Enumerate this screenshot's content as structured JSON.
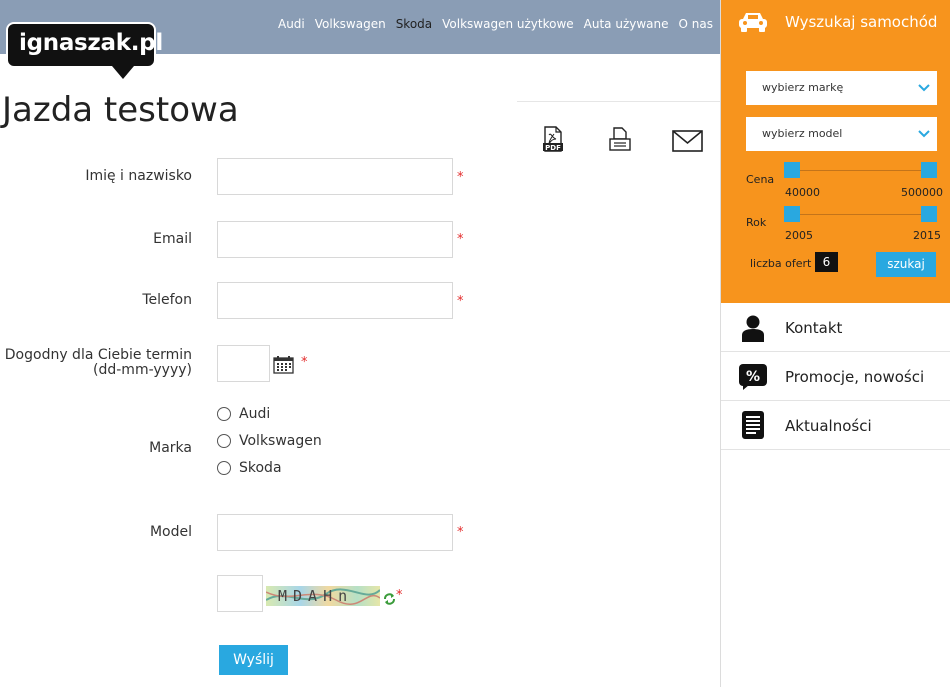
{
  "brand": {
    "logo_text": "ignaszak.pl"
  },
  "nav": {
    "items": [
      {
        "label": "Audi"
      },
      {
        "label": "Volkswagen"
      },
      {
        "label": "Skoda",
        "active": true
      },
      {
        "label": "Volkswagen użytkowe"
      },
      {
        "label": "Auta używane"
      },
      {
        "label": "O nas"
      }
    ]
  },
  "page": {
    "title": "Jazda testowa"
  },
  "tools": {
    "icons": [
      "pdf-icon",
      "print-icon",
      "mail-icon"
    ]
  },
  "form": {
    "name_label": "Imię i nazwisko",
    "email_label": "Email",
    "phone_label": "Telefon",
    "date_label_1": "Dogodny dla Ciebie termin",
    "date_label_2": "(dd-mm-yyyy)",
    "brand_label": "Marka",
    "brands": [
      "Audi",
      "Volkswagen",
      "Skoda"
    ],
    "model_label": "Model",
    "required_mark": "*",
    "captcha_text": "MDAHn",
    "submit_label": "Wyślij"
  },
  "search": {
    "title": "Wyszukaj samochód",
    "make_placeholder": "wybierz markę",
    "model_placeholder": "wybierz model",
    "price_label": "Cena",
    "price_min": "40000",
    "price_max": "500000",
    "year_label": "Rok",
    "year_min": "2005",
    "year_max": "2015",
    "offers_label": "liczba ofert",
    "offers_count": "6",
    "search_button": "szukaj"
  },
  "sidebar": {
    "items": [
      {
        "label": "Kontakt",
        "icon": "person-icon"
      },
      {
        "label": "Promocje, nowości",
        "icon": "percent-icon"
      },
      {
        "label": "Aktualności",
        "icon": "document-icon"
      }
    ]
  },
  "colors": {
    "accent_orange": "#f7941d",
    "accent_blue": "#29a8e0",
    "header": "#8a9db5"
  }
}
